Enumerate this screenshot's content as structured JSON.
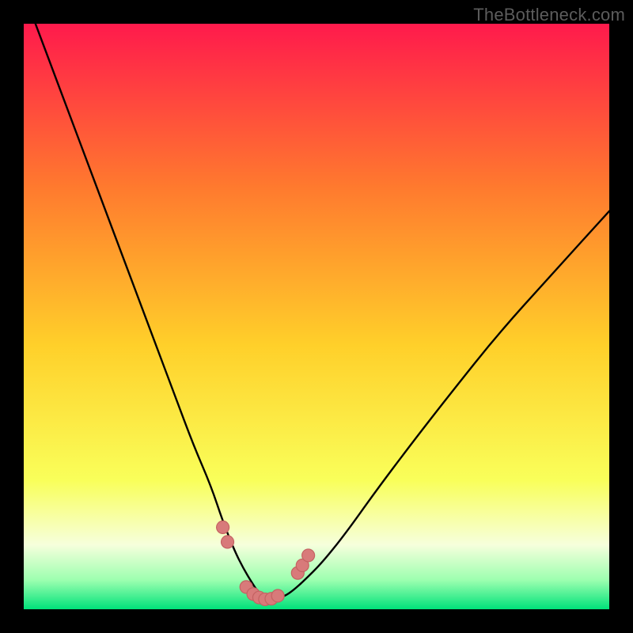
{
  "watermark": "TheBottleneck.com",
  "colors": {
    "frame_bg": "#000000",
    "grad_top": "#ff1a4c",
    "grad_mid_upper": "#ff7a2e",
    "grad_mid": "#ffd02a",
    "grad_lower": "#f9ff5a",
    "grad_band": "#f6ffdc",
    "grad_green1": "#9dffb0",
    "grad_green2": "#00e27a",
    "curve": "#000000",
    "marker_fill": "#d87a7a",
    "marker_stroke": "#c46262"
  },
  "chart_data": {
    "type": "line",
    "title": "",
    "xlabel": "",
    "ylabel": "",
    "xlim": [
      0,
      100
    ],
    "ylim": [
      0,
      100
    ],
    "grid": false,
    "series": [
      {
        "name": "bottleneck-curve",
        "x": [
          2,
          5,
          8,
          11,
          14,
          17,
          20,
          23,
          26,
          29,
          32,
          34,
          36,
          37.5,
          39,
          40,
          41,
          42,
          43,
          44.5,
          46,
          48,
          51,
          55,
          60,
          66,
          73,
          81,
          90,
          100
        ],
        "y": [
          100,
          92,
          84,
          76,
          68,
          60,
          52,
          44,
          36,
          28,
          21,
          15,
          10,
          7,
          4.5,
          3,
          2,
          1.6,
          1.8,
          2.2,
          3.2,
          5,
          8,
          13,
          20,
          28,
          37,
          47,
          57,
          68
        ]
      }
    ],
    "markers": [
      {
        "name": "left-cluster-1",
        "x": 34.0,
        "y": 14.0
      },
      {
        "name": "left-cluster-2",
        "x": 34.8,
        "y": 11.5
      },
      {
        "name": "trough-1",
        "x": 38.0,
        "y": 3.8
      },
      {
        "name": "trough-2",
        "x": 39.2,
        "y": 2.6
      },
      {
        "name": "trough-3",
        "x": 40.2,
        "y": 2.0
      },
      {
        "name": "trough-4",
        "x": 41.2,
        "y": 1.7
      },
      {
        "name": "trough-5",
        "x": 42.3,
        "y": 1.8
      },
      {
        "name": "trough-6",
        "x": 43.4,
        "y": 2.3
      },
      {
        "name": "right-cluster-1",
        "x": 46.8,
        "y": 6.2
      },
      {
        "name": "right-cluster-2",
        "x": 47.6,
        "y": 7.5
      },
      {
        "name": "right-cluster-3",
        "x": 48.6,
        "y": 9.2
      }
    ],
    "marker_radius_px": 8
  }
}
